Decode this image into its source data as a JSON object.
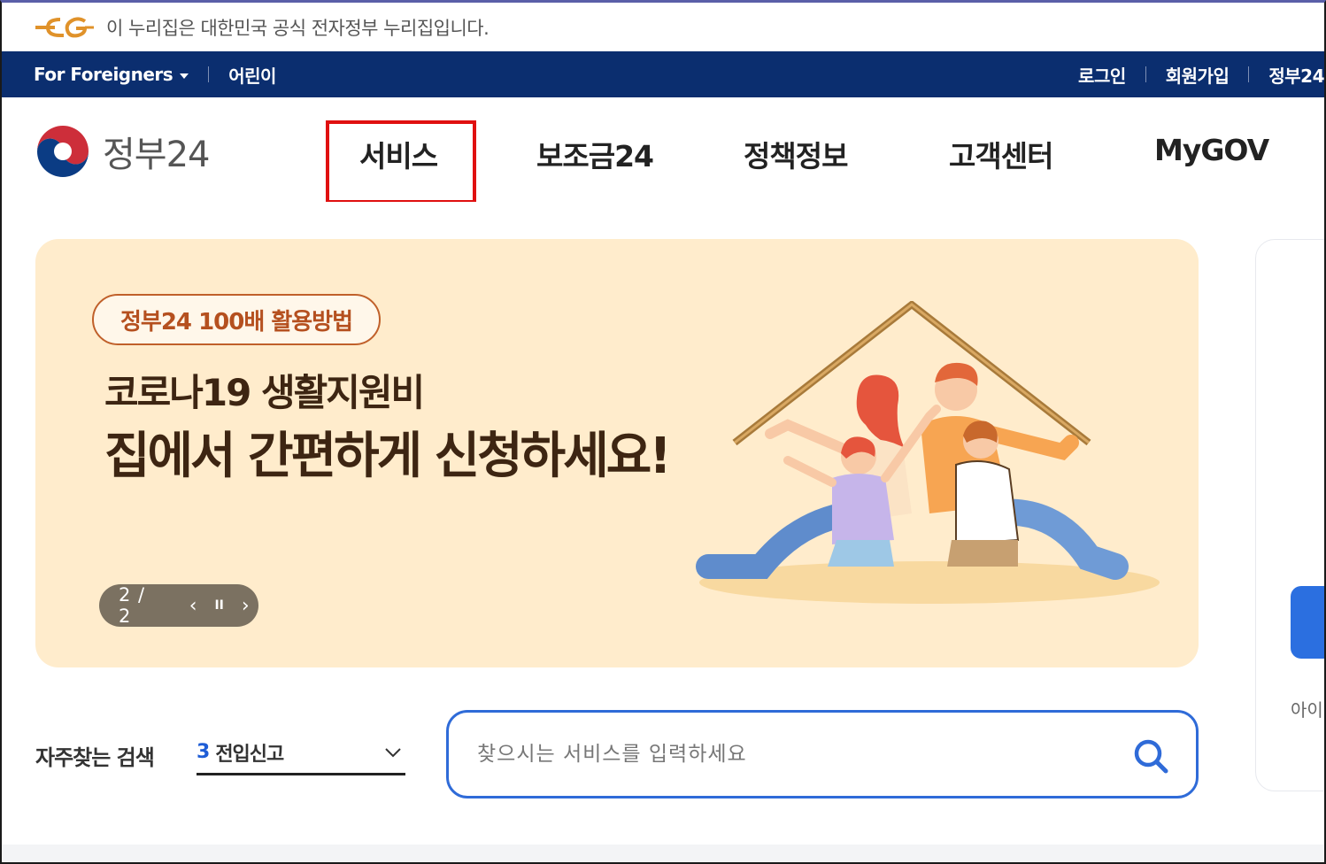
{
  "notice": {
    "text": "이 누리집은 대한민국 공식 전자정부 누리집입니다."
  },
  "utility": {
    "left": [
      {
        "label": "For Foreigners"
      },
      {
        "label": "어린이"
      }
    ],
    "right": [
      {
        "label": "로그인"
      },
      {
        "label": "회원가입"
      },
      {
        "label": "정부24"
      }
    ]
  },
  "header": {
    "brand": "정부24",
    "nav": [
      "서비스",
      "보조금24",
      "정책정보",
      "고객센터",
      "MyGOV"
    ]
  },
  "banner": {
    "tag": "정부24 100배 활용방법",
    "line1": "코로나19 생활지원비",
    "line2": "집에서 간편하게 신청하세요!",
    "counter": "2 / 2",
    "prev_icon": "‹",
    "pause_icon": "II",
    "next_icon": "›"
  },
  "side": {
    "text": "아이"
  },
  "search": {
    "frequent_label": "자주찾는 검색",
    "frequent_rank": "3",
    "frequent_item": "전입신고",
    "placeholder": "찾으시는 서비스를 입력하세요"
  },
  "colors": {
    "utility_bar": "#0b2e6f",
    "banner_bg": "#ffeccc",
    "highlight": "#e01010",
    "accent_blue": "#2f6bd8",
    "tag_orange": "#c0602a"
  }
}
